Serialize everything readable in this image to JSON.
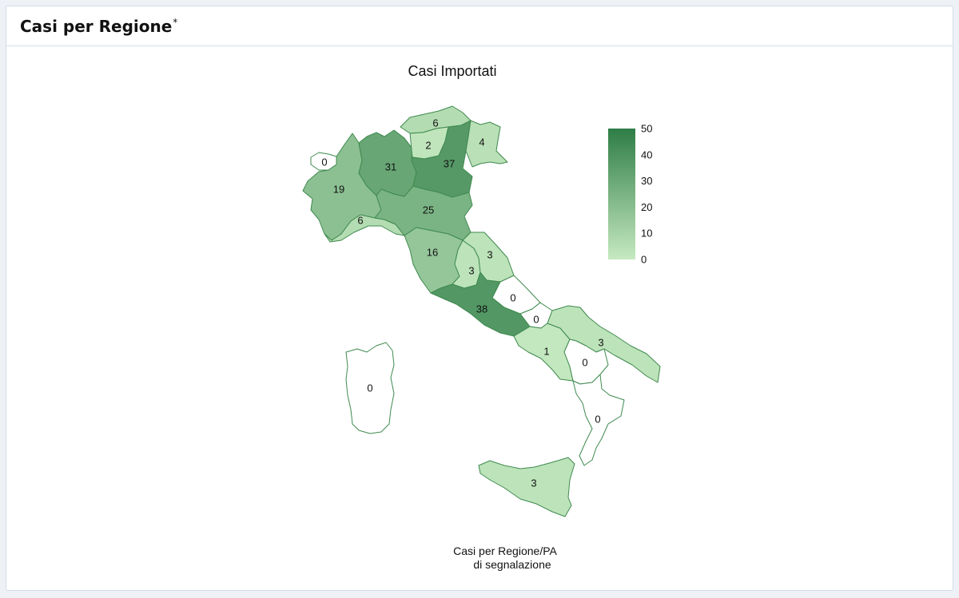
{
  "card": {
    "title": "Casi per Regione",
    "title_mark": "*"
  },
  "chart": {
    "title": "Casi Importati",
    "caption_line1": "Casi per Regione/PA",
    "caption_line2": "di segnalazione",
    "legend": {
      "min": 0,
      "max": 50,
      "ticks": [
        "50",
        "40",
        "30",
        "20",
        "10",
        "0"
      ],
      "color_low": "#c6e9c1",
      "color_high": "#2e7d46"
    }
  },
  "chart_data": {
    "type": "choropleth",
    "title": "Casi Importati",
    "value_range": [
      0,
      50
    ],
    "regions": [
      {
        "id": "valle-d-aosta",
        "value": 0
      },
      {
        "id": "piemonte",
        "value": 19
      },
      {
        "id": "lombardia",
        "value": 31
      },
      {
        "id": "trentino",
        "value": 6
      },
      {
        "id": "alto-adige",
        "value": 2
      },
      {
        "id": "veneto",
        "value": 37
      },
      {
        "id": "friuli-venezia-giulia",
        "value": 4
      },
      {
        "id": "liguria",
        "value": 6
      },
      {
        "id": "emilia-romagna",
        "value": 25
      },
      {
        "id": "toscana",
        "value": 16
      },
      {
        "id": "umbria",
        "value": 3
      },
      {
        "id": "marche",
        "value": 3
      },
      {
        "id": "lazio",
        "value": 38
      },
      {
        "id": "abruzzo",
        "value": 0
      },
      {
        "id": "molise",
        "value": 0
      },
      {
        "id": "campania",
        "value": 1
      },
      {
        "id": "puglia",
        "value": 3
      },
      {
        "id": "basilicata",
        "value": 0
      },
      {
        "id": "calabria",
        "value": 0
      },
      {
        "id": "sicilia",
        "value": 3
      },
      {
        "id": "sardegna",
        "value": 0
      }
    ]
  }
}
